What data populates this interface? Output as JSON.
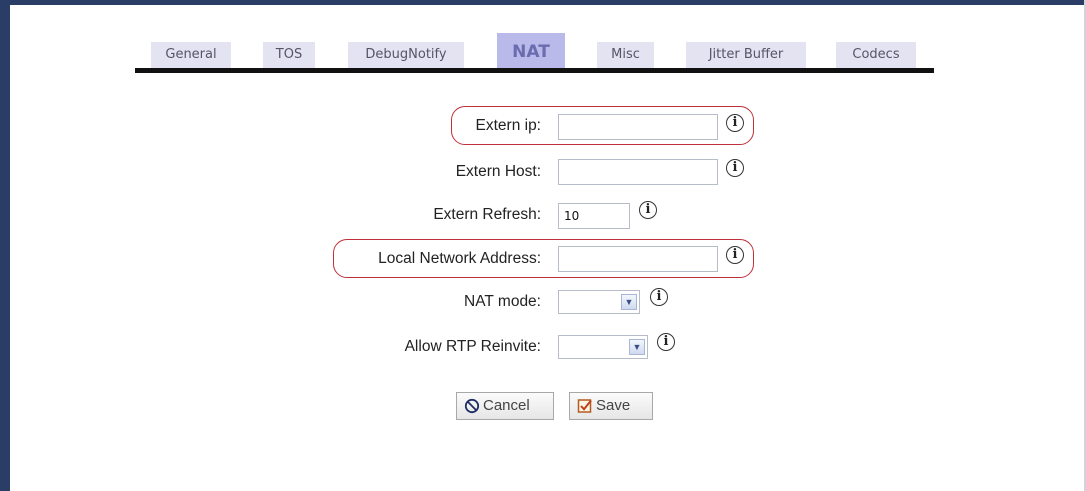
{
  "tabs": {
    "items": [
      {
        "label": "General"
      },
      {
        "label": "TOS"
      },
      {
        "label": "DebugNotify"
      },
      {
        "label": "NAT"
      },
      {
        "label": "Misc"
      },
      {
        "label": "Jitter Buffer"
      },
      {
        "label": "Codecs"
      }
    ],
    "active": "NAT"
  },
  "form": {
    "extern_ip": {
      "label": "Extern ip:",
      "value": "",
      "highlighted": true
    },
    "extern_host": {
      "label": "Extern Host:",
      "value": ""
    },
    "extern_refresh": {
      "label": "Extern Refresh:",
      "value": "10"
    },
    "local_network_address": {
      "label": "Local Network Address:",
      "value": "",
      "highlighted": true
    },
    "nat_mode": {
      "label": "NAT mode:",
      "selected": ""
    },
    "allow_rtp_reinvite": {
      "label": "Allow RTP Reinvite:",
      "selected": ""
    }
  },
  "buttons": {
    "cancel_label": "Cancel",
    "save_label": "Save"
  },
  "colors": {
    "frame": "#2a3d66",
    "tab_bg": "#e3e3f2",
    "tab_active_bg": "#b9b9ea",
    "highlight": "#c0303a"
  },
  "icons": {
    "info": "info-icon",
    "dropdown": "chevron-down-icon",
    "cancel": "no-entry-icon",
    "save": "checkbox-icon"
  }
}
